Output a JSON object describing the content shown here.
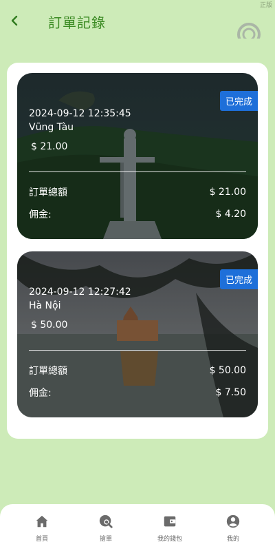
{
  "corner_tag": "正版",
  "header": {
    "back_icon": "chevron-left-icon",
    "title": "訂單記錄",
    "logo_icon": "partial-logo-icon"
  },
  "colors": {
    "page_bg": "#cdebb8",
    "title_green": "#3a8a22",
    "status_blue": "#1e6fd9",
    "nav_gray": "#6b6b6b"
  },
  "orders": [
    {
      "status": "已完成",
      "datetime": "2024-09-12 12:35:45",
      "city": "Vũng Tàu",
      "price": "$ 21.00",
      "total_label": "訂單總額",
      "total_value": "$ 21.00",
      "commission_label": "佣金:",
      "commission_value": "$ 4.20",
      "image": "vung-tau-christ-statue-aerial"
    },
    {
      "status": "已完成",
      "datetime": "2024-09-12 12:27:42",
      "city": "Hà Nội",
      "price": "$ 50.00",
      "total_label": "訂單總額",
      "total_value": "$ 50.00",
      "commission_label": "佣金:",
      "commission_value": "$ 7.50",
      "image": "hanoi-turtle-tower-lake"
    }
  ],
  "nav": [
    {
      "label": "首頁",
      "icon": "home-icon"
    },
    {
      "label": "搶單",
      "icon": "search-order-icon"
    },
    {
      "label": "我的錢包",
      "icon": "wallet-icon"
    },
    {
      "label": "我的",
      "icon": "user-icon"
    }
  ]
}
